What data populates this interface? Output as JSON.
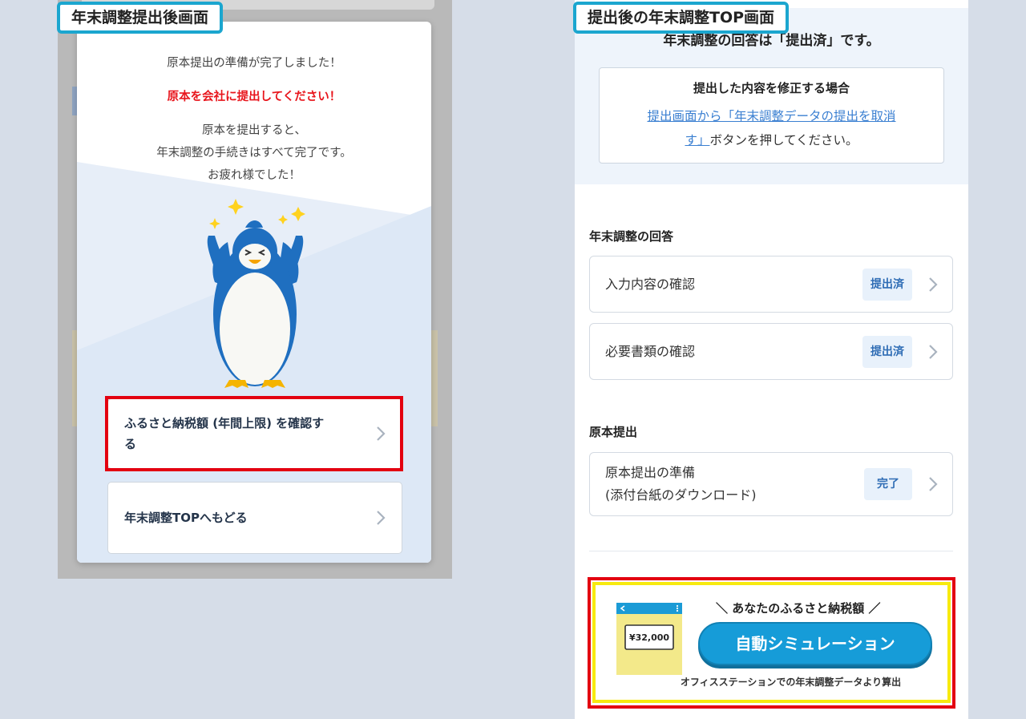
{
  "left_label": "年末調整提出後画面",
  "right_label": "提出後の年末調整TOP画面",
  "modal": {
    "line1": "原本提出の準備が完了しました！",
    "line2": "原本を会社に提出してください！",
    "line3": "原本を提出すると、",
    "line4": "年末調整の手続きはすべて完了です。",
    "line5": "お疲れ様でした！",
    "button1_line1": "ふるさと納税額 (年間上限) を確認す",
    "button1_line2": "る",
    "button2": "年末調整TOPへもどる"
  },
  "top_page": {
    "status_text": "年末調整の回答は「提出済」です。",
    "notice_title": "提出した内容を修正する場合",
    "notice_link_line1": "提出画面から「年末調整データの提出を取消",
    "notice_link_line2": "す」",
    "notice_text_rest": "ボタンを押してください。",
    "section1_title": "年末調整の回答",
    "items": [
      {
        "label": "入力内容の確認",
        "badge": "提出済"
      },
      {
        "label": "必要書類の確認",
        "badge": "提出済"
      }
    ],
    "section2_title": "原本提出",
    "doc_item": {
      "label_line1": "原本提出の準備",
      "label_line2": "(添付台紙のダウンロード)",
      "badge": "完了"
    }
  },
  "promo": {
    "headline": "＼ あなたのふるさと納税額 ／",
    "button": "自動シミュレーション",
    "footer": "オフィスステーションでの年末調整データより算出",
    "phone_amount": "¥32,000"
  },
  "colors": {
    "tag_border": "#1ba6cf",
    "highlight_red": "#e30010",
    "promo_yellow": "#f7ea0f",
    "accent_blue": "#169cd8"
  }
}
